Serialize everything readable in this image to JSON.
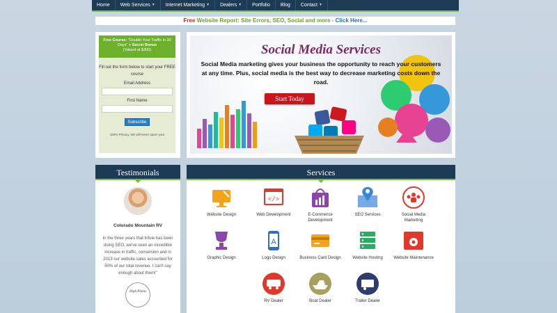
{
  "nav": {
    "items": [
      {
        "label": "Home",
        "caret": false
      },
      {
        "label": "Web Services",
        "caret": true
      },
      {
        "label": "Internet Marketing",
        "caret": true
      },
      {
        "label": "Dealers",
        "caret": true
      },
      {
        "label": "Portfolio",
        "caret": false
      },
      {
        "label": "Blog",
        "caret": false
      },
      {
        "label": "Contact",
        "caret": true
      }
    ]
  },
  "report": {
    "free": "Free",
    "message": "Website Report: Site Errors, SEO, Social and more -",
    "link": "Click Here..."
  },
  "optin": {
    "course_bold": "Free Course:",
    "course_title": "\"Double Your Traffic in 30 Days\"",
    "bonus": "+ Secret Bonus",
    "value": "(Valued at $300)",
    "intro": "Fill out the form below to start your FREE course",
    "email_label": "Email Address",
    "name_label": "First Name",
    "subscribe": "Subscribe",
    "privacy": "100% Privacy. We will never spam you!"
  },
  "hero": {
    "title": "Social Media Services",
    "body": "Social Media marketing gives your business the opportunity to reach your customers at any time. Plus, social media is the best way to decrease marketing costs down the road.",
    "button": "Start Today"
  },
  "testimonials": {
    "heading": "Testimonials",
    "name": "Colorado Mountain RV",
    "quote": "In the three years that Infule has been doing SEO, we've seen an incredible increase in traffic, conversion and in 2013 our website sales accounted for 50% of our total revenue. I can't say enough about them!\"",
    "logo_text": "High Plains"
  },
  "services": {
    "heading": "Services",
    "items": [
      {
        "label": "Website Design",
        "icon": "monitor-pencil-icon",
        "color": "#f5a21c"
      },
      {
        "label": "Web Development",
        "icon": "code-window-icon",
        "color": "#e0392b"
      },
      {
        "label": "E-Commerce Development",
        "icon": "shopping-bag-icon",
        "color": "#8e44ad"
      },
      {
        "label": "SEO Services",
        "icon": "map-pin-icon",
        "color": "#3a86d9"
      },
      {
        "label": "Social Media Marketing",
        "icon": "people-network-icon",
        "color": "#e0392b"
      },
      {
        "label": "Graphic Design",
        "icon": "trophy-icon",
        "color": "#8e44ad"
      },
      {
        "label": "Logo Design",
        "icon": "phone-logo-icon",
        "color": "#2c6fc4"
      },
      {
        "label": "Business Card Design",
        "icon": "credit-card-icon",
        "color": "#f5a21c"
      },
      {
        "label": "Website Hosting",
        "icon": "server-icon",
        "color": "#27ae60"
      },
      {
        "label": "Website Maintenance",
        "icon": "gear-window-icon",
        "color": "#e0392b"
      },
      {
        "label": "RV Dealer",
        "icon": "rv-icon",
        "color": "#e0392b"
      },
      {
        "label": "Boat Dealer",
        "icon": "boat-icon",
        "color": "#a8a060"
      },
      {
        "label": "Trailer Dealer",
        "icon": "trailer-icon",
        "color": "#2c3e6b"
      }
    ]
  }
}
